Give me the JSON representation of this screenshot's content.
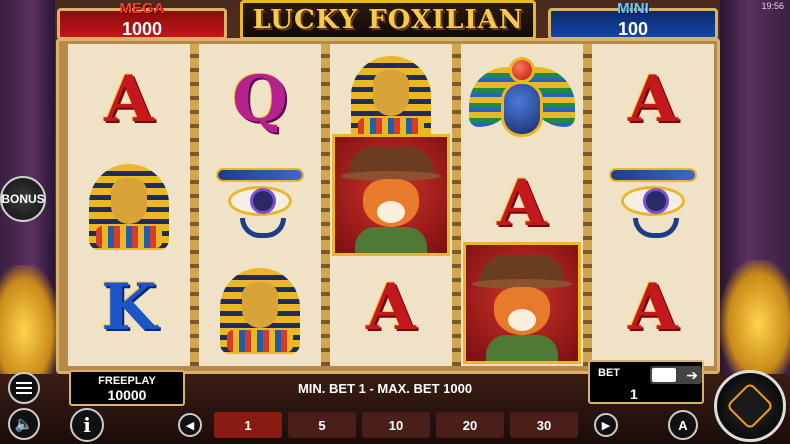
{
  "status": {
    "clock": "19:56"
  },
  "jackpots": {
    "mega": {
      "label": "MEGA",
      "value": "1000"
    },
    "mini": {
      "label": "MINI",
      "value": "100"
    }
  },
  "logo": {
    "text": "LUCKY FOXILIAN"
  },
  "bonus": {
    "label": "BONUS"
  },
  "reels": [
    [
      "A",
      "pharaoh",
      "K"
    ],
    [
      "Q",
      "eye-of-horus",
      "pharaoh"
    ],
    [
      "pharaoh",
      "fox",
      "A"
    ],
    [
      "scarab",
      "A",
      "fox"
    ],
    [
      "A",
      "eye-of-horus",
      "A"
    ]
  ],
  "freeplay": {
    "label": "FREEPLAY",
    "value": "10000"
  },
  "limits": {
    "text": "MIN. BET 1 - MAX. BET 1000"
  },
  "bet": {
    "label": "BET",
    "value": "1"
  },
  "coins": {
    "values": [
      "1",
      "5",
      "10",
      "20",
      "30"
    ],
    "selected": "1"
  },
  "icons": {
    "menu": "menu-icon",
    "sound": "speaker-icon",
    "info": "info-icon",
    "prev": "chevron-left-icon",
    "next": "chevron-right-icon",
    "auto": "autoplay-icon",
    "spin": "spin-icon"
  },
  "colors": {
    "mega": "#c3151a",
    "mini": "#1545a8",
    "gold": "#e9b824"
  }
}
